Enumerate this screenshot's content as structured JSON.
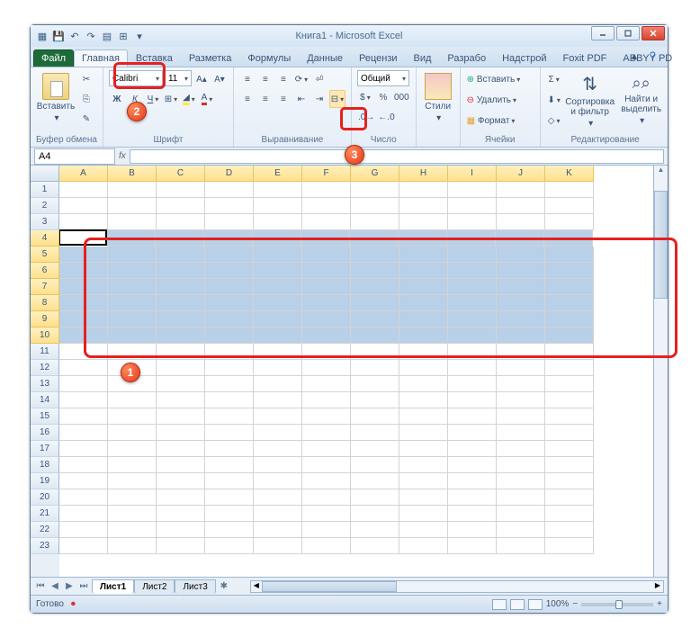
{
  "title": "Книга1 - Microsoft Excel",
  "tabs": {
    "file": "Файл",
    "items": [
      "Главная",
      "Вставка",
      "Разметка",
      "Формулы",
      "Данные",
      "Рецензи",
      "Вид",
      "Разрабо",
      "Надстрой",
      "Foxit PDF",
      "ABBYY PD"
    ],
    "active_index": 0
  },
  "ribbon": {
    "clipboard": {
      "paste": "Вставить",
      "label": "Буфер обмена"
    },
    "font": {
      "name": "Calibri",
      "size": "11",
      "label": "Шрифт"
    },
    "align": {
      "label": "Выравнивание"
    },
    "number": {
      "format": "Общий",
      "label": "Число"
    },
    "styles": {
      "btn": "Стили",
      "label": ""
    },
    "cells": {
      "insert": "Вставить",
      "delete": "Удалить",
      "format": "Формат",
      "label": "Ячейки"
    },
    "editing": {
      "sort": "Сортировка и фильтр",
      "find": "Найти и выделить",
      "label": "Редактирование"
    }
  },
  "namebox": "A4",
  "columns": [
    "A",
    "B",
    "C",
    "D",
    "E",
    "F",
    "G",
    "H",
    "I",
    "J",
    "K"
  ],
  "row_count": 23,
  "selection": {
    "row_start": 4,
    "row_end": 10,
    "active_cell": "A4"
  },
  "sheets": {
    "items": [
      "Лист1",
      "Лист2",
      "Лист3"
    ],
    "active": 0
  },
  "status": {
    "text": "Готово",
    "zoom": "100%"
  },
  "badges": {
    "b1": "1",
    "b2": "2",
    "b3": "3"
  }
}
